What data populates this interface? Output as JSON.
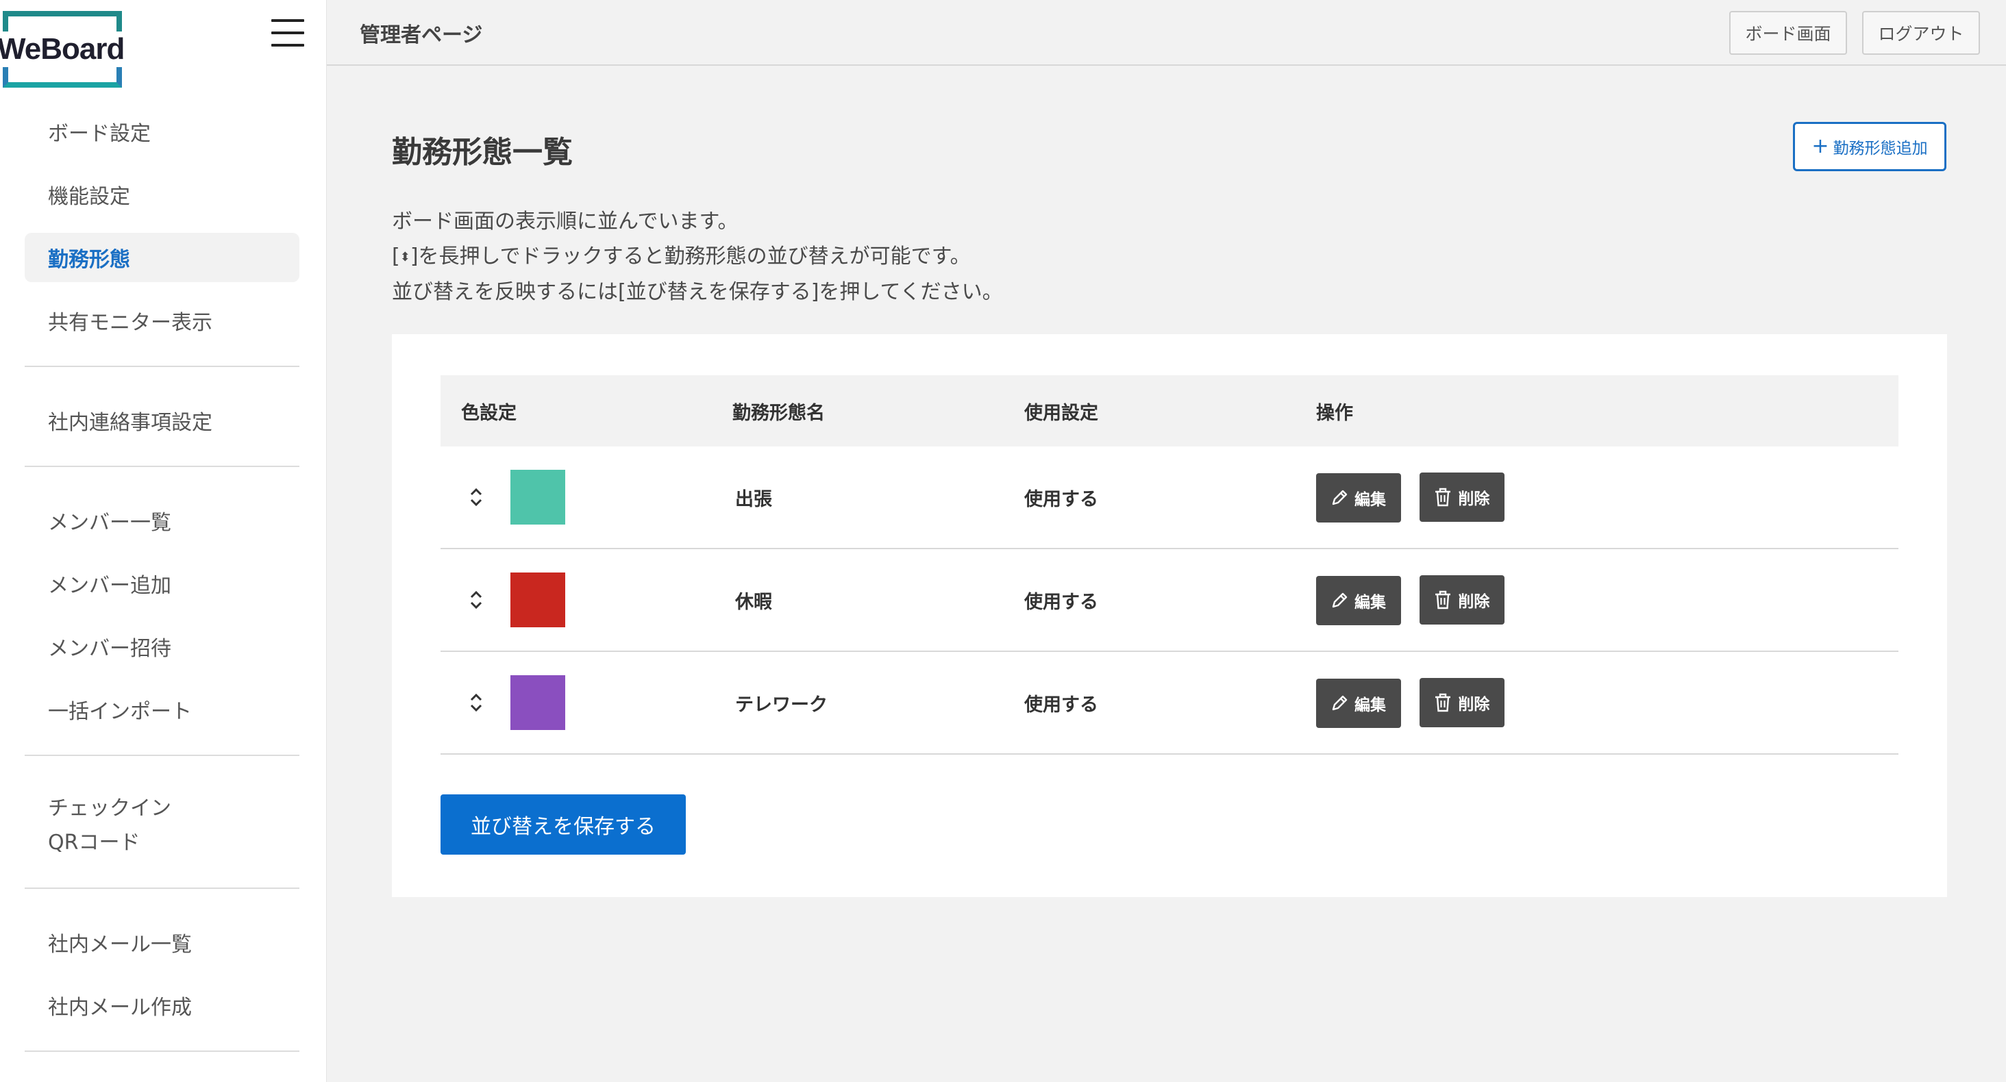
{
  "brand": {
    "logo_text": "WeBoard",
    "accent": "#1a6fc4"
  },
  "header": {
    "title": "管理者ページ",
    "board_button": "ボード画面",
    "logout_button": "ログアウト"
  },
  "sidebar": {
    "groups": [
      [
        {
          "label": "ボード設定",
          "active": false
        },
        {
          "label": "機能設定",
          "active": false
        },
        {
          "label": "勤務形態",
          "active": true
        },
        {
          "label": "共有モニター表示",
          "active": false
        }
      ],
      [
        {
          "label": "社内連絡事項設定",
          "active": false
        }
      ],
      [
        {
          "label": "メンバー一覧",
          "active": false
        },
        {
          "label": "メンバー追加",
          "active": false
        },
        {
          "label": "メンバー招待",
          "active": false
        },
        {
          "label": "一括インポート",
          "active": false
        }
      ],
      [
        {
          "label_line1": "チェックイン",
          "label_line2": "QRコード",
          "active": false
        }
      ],
      [
        {
          "label": "社内メール一覧",
          "active": false
        },
        {
          "label": "社内メール作成",
          "active": false
        }
      ]
    ]
  },
  "main": {
    "title": "勤務形態一覧",
    "add_button": "勤務形態追加",
    "description": {
      "line1": "ボード画面の表示順に並んでいます。",
      "line2_before": "[",
      "line2_glyph": "⬍",
      "line2_after": "]を長押しでドラックすると勤務形態の並び替えが可能です。",
      "line3": "並び替えを反映するには[並び替えを保存する]を押してください。"
    },
    "table": {
      "headers": [
        "色設定",
        "勤務形態名",
        "使用設定",
        "操作"
      ],
      "rows": [
        {
          "color": "#4fc4aa",
          "name": "出張",
          "usage": "使用する",
          "edit": "編集",
          "delete": "削除"
        },
        {
          "color": "#c9271f",
          "name": "休暇",
          "usage": "使用する",
          "edit": "編集",
          "delete": "削除"
        },
        {
          "color": "#8a4fbf",
          "name": "テレワーク",
          "usage": "使用する",
          "edit": "編集",
          "delete": "削除"
        }
      ]
    },
    "save_button": "並び替えを保存する"
  }
}
